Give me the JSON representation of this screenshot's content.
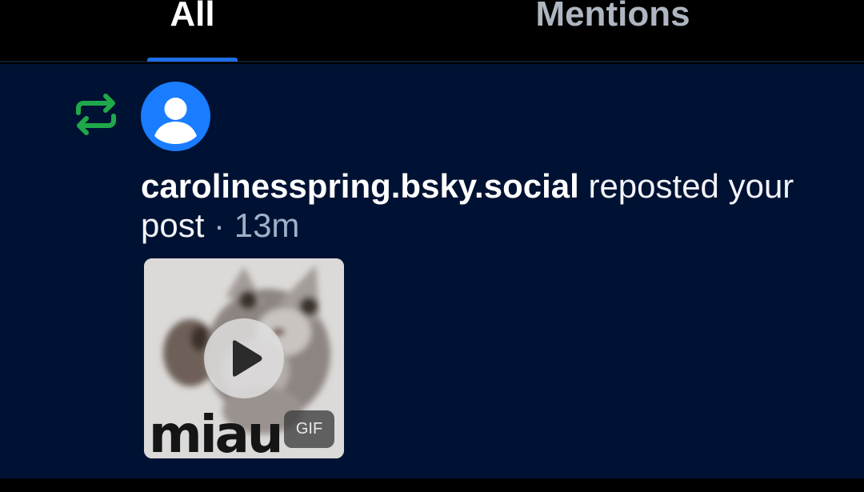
{
  "tabs": [
    {
      "label": "All",
      "active": true
    },
    {
      "label": "Mentions",
      "active": false
    }
  ],
  "colors": {
    "accent": "#1f6fe6",
    "background": "#001233",
    "repost_icon": "#1fa84a",
    "avatar": "#1a7cff"
  },
  "notification": {
    "type_icon": "repost-icon",
    "avatar_icon": "default-avatar-icon",
    "handle": "carolinesspring.bsky.social",
    "action": " reposted your post",
    "separator": " · ",
    "time": "13m",
    "media": {
      "caption": "miau",
      "badge": "GIF",
      "play_icon": "play-icon"
    }
  }
}
